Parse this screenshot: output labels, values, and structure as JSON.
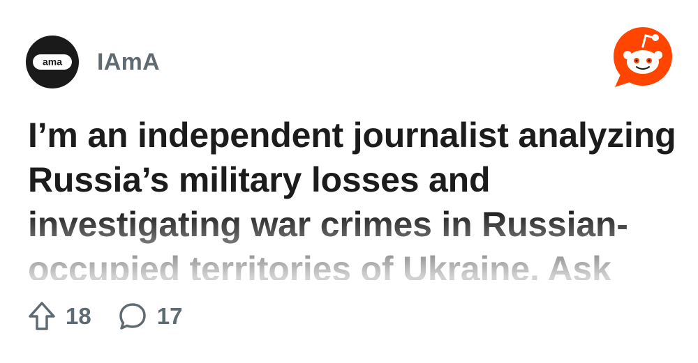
{
  "post": {
    "subreddit": "IAmA",
    "avatar_text": "ama",
    "title": "I’m an independent journalist analyzing Russia’s military losses and investigating war crimes in Russian-occupied territories of Ukraine. Ask",
    "upvotes": "18",
    "comments": "17"
  },
  "icons": {
    "subreddit_avatar": "ama-logo-icon",
    "brand": "reddit-logo-icon",
    "upvote": "upvote-arrow-icon",
    "comment": "comment-bubble-icon"
  },
  "colors": {
    "brand": "#ff4500",
    "avatar_bg": "#1a1a1b",
    "title_text": "#1c1c1c",
    "meta_text": "#5f6b73"
  }
}
